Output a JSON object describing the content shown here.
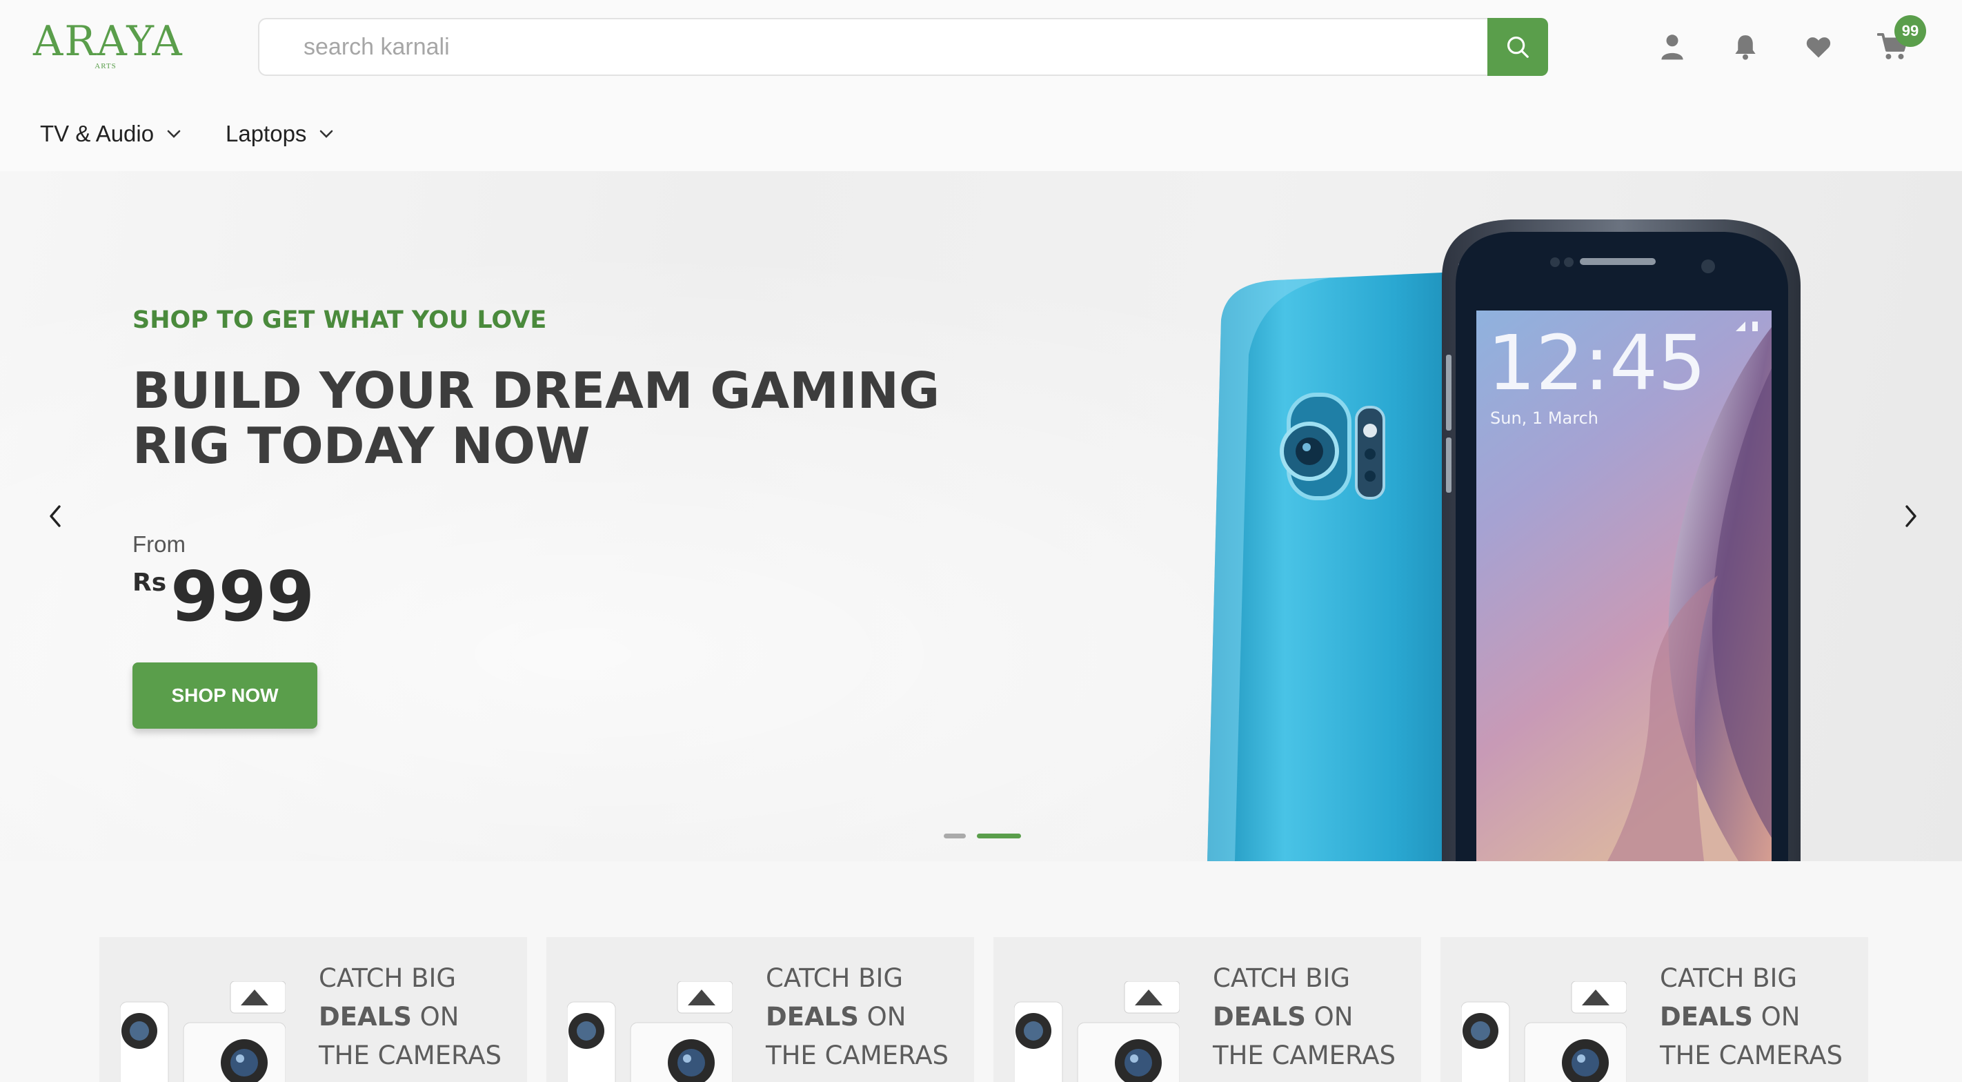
{
  "brand": {
    "name": "ARAYA",
    "sub": "ARTS",
    "color": "#5a9e4b"
  },
  "search": {
    "placeholder": "search karnali",
    "button_icon": "search-icon"
  },
  "header_icons": [
    {
      "name": "user-icon"
    },
    {
      "name": "bell-icon"
    },
    {
      "name": "heart-icon"
    },
    {
      "name": "cart-icon"
    }
  ],
  "cart": {
    "badge_count": "99"
  },
  "nav": {
    "items": [
      {
        "label": "TV & Audio",
        "icon": "chevron-down-icon"
      },
      {
        "label": "Laptops",
        "icon": "chevron-down-icon"
      }
    ]
  },
  "hero": {
    "tagline": "SHOP TO GET WHAT YOU LOVE",
    "headline_line1": "BUILD YOUR DREAM GAMING",
    "headline_line2": "RIG TODAY NOW",
    "from_label": "From",
    "currency": "Rs",
    "price": "999",
    "cta_label": "SHOP NOW",
    "prev_icon": "chevron-left-icon",
    "next_icon": "chevron-right-icon",
    "slides_total": 2,
    "active_slide": 2,
    "phone_time": "12:45",
    "phone_date": "Sun, 1 March"
  },
  "promo_cards": [
    {
      "line1": "CATCH BIG",
      "line2_bold": "DEALS",
      "line2_rest": " ON",
      "line3": "THE CAMERAS"
    },
    {
      "line1": "CATCH BIG",
      "line2_bold": "DEALS",
      "line2_rest": " ON",
      "line3": "THE CAMERAS"
    },
    {
      "line1": "CATCH BIG",
      "line2_bold": "DEALS",
      "line2_rest": " ON",
      "line3": "THE CAMERAS"
    },
    {
      "line1": "CATCH BIG",
      "line2_bold": "DEALS",
      "line2_rest": " ON",
      "line3": "THE CAMERAS"
    }
  ],
  "colors": {
    "accent": "#5a9e4b",
    "tagline": "#4a8a3c",
    "headline": "#3d3d3d",
    "dot_inactive": "#aaaaaa"
  }
}
